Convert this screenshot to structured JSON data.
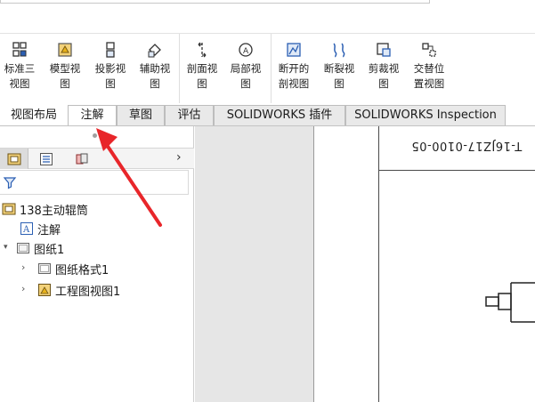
{
  "ribbon": {
    "tools": [
      {
        "label": "标准三\n视图",
        "icon": "standard-three-view-icon"
      },
      {
        "label": "模型视\n图",
        "icon": "model-view-icon"
      },
      {
        "label": "投影视\n图",
        "icon": "projected-view-icon"
      },
      {
        "label": "辅助视\n图",
        "icon": "auxiliary-view-icon"
      },
      {
        "label": "剖面视\n图",
        "icon": "section-view-icon"
      },
      {
        "label": "局部视\n图",
        "icon": "detail-view-icon"
      },
      {
        "label": "断开的\n剖视图",
        "icon": "broken-out-section-icon"
      },
      {
        "label": "断裂视\n图",
        "icon": "break-view-icon"
      },
      {
        "label": "剪裁视\n图",
        "icon": "crop-view-icon"
      },
      {
        "label": "交替位\n置视图",
        "icon": "alternate-position-view-icon"
      }
    ]
  },
  "tabs": [
    {
      "label": "视图布局"
    },
    {
      "label": "注解"
    },
    {
      "label": "草图"
    },
    {
      "label": "评估"
    },
    {
      "label": "SOLIDWORKS 插件"
    },
    {
      "label": "SOLIDWORKS Inspection"
    }
  ],
  "active_tab": "注解",
  "feature_tree": {
    "panel_tabs": [
      "feature-manager-icon",
      "property-manager-icon",
      "config-manager-icon"
    ],
    "more": "›",
    "items": [
      {
        "label": "138主动辊筒",
        "icon": "drawing-document-icon"
      },
      {
        "label": "注解",
        "icon": "annotations-icon"
      },
      {
        "label": "图纸1",
        "icon": "sheet-icon",
        "expander": "▾"
      },
      {
        "label": "图纸格式1",
        "icon": "sheet-format-icon",
        "expander": "›"
      },
      {
        "label": "工程图视图1",
        "icon": "drawing-view-icon",
        "expander": "›"
      }
    ]
  },
  "drawing": {
    "title_block_text": "T-16JZ17-0100-05"
  },
  "colors": {
    "pointer_arrow": "#e8262a",
    "accent_blue": "#2b5fb3",
    "accent_yellow": "#e8b21a"
  }
}
